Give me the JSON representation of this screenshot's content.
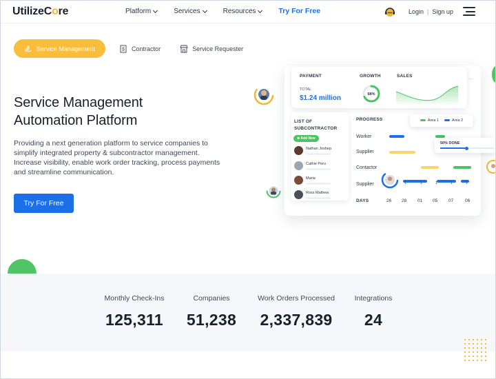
{
  "header": {
    "logo_prefix": "UtilizeC",
    "logo_o": "o",
    "logo_suffix": "re",
    "nav": [
      {
        "label": "Platform"
      },
      {
        "label": "Services"
      },
      {
        "label": "Resources"
      }
    ],
    "cta": "Try For Free",
    "login": "Login",
    "separator": "|",
    "signup": "Sign up"
  },
  "tabs": [
    {
      "label": "Service Management",
      "active": true,
      "icon": "hand-money-icon"
    },
    {
      "label": "Contractor",
      "active": false,
      "icon": "dollar-doc-icon"
    },
    {
      "label": "Service Requester",
      "active": false,
      "icon": "store-icon"
    }
  ],
  "hero": {
    "title_line1": "Service Management",
    "title_line2": "Automation Platform",
    "description": "Providing a next generation platform to service companies to simplify integrated property & subcontractor management. Increase visibility, enable work order tracking, process payments and streamline communication.",
    "button": "Try For Free"
  },
  "dashboard": {
    "payment_label": "PAYMENT",
    "total_label": "TOTAL",
    "total_value": "$1.24 million",
    "growth_label": "GROWTH",
    "growth_value": "68%",
    "growth_fraction": 0.68,
    "sales_label": "SALES",
    "list_title_line1": "LIST OF",
    "list_title_line2": "SUBCONTRACTOR",
    "add_new": "Add New",
    "people": [
      {
        "name": "Nathan Joshep"
      },
      {
        "name": "Cathie Peru"
      },
      {
        "name": "Maria"
      },
      {
        "name": "Ross Mathew"
      }
    ],
    "progress_label": "PROGRESS",
    "rows": [
      "Worker",
      "Supplier",
      "Contactor",
      "Supplier"
    ],
    "days_label": "DAYS",
    "days": [
      "26",
      "28",
      "01",
      "05",
      "07",
      "06"
    ],
    "ticks": [
      "1",
      "1",
      "1",
      "1",
      "1"
    ],
    "legend": [
      {
        "label": "Area 1",
        "color": "#4cc262"
      },
      {
        "label": "Area 2",
        "color": "#1d6fe8"
      }
    ],
    "done_label": "50% DONE",
    "done_fraction": 0.5
  },
  "stats": [
    {
      "label": "Monthly Check-Ins",
      "value": "125,311"
    },
    {
      "label": "Companies",
      "value": "51,238"
    },
    {
      "label": "Work Orders Processed",
      "value": "2,337,839"
    },
    {
      "label": "Integrations",
      "value": "24"
    }
  ],
  "colors": {
    "accent_blue": "#1d6fe8",
    "accent_yellow": "#f8bd3a",
    "accent_green": "#4cc262"
  }
}
